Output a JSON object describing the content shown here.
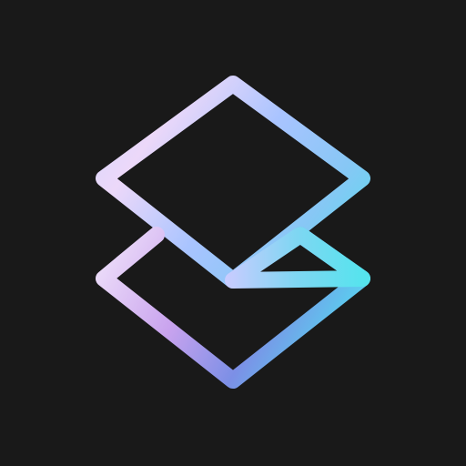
{
  "icon": {
    "name": "stacked-layers-icon",
    "background_color": "#191919",
    "gradient_colors": [
      "#f3e3fb",
      "#c9c6ff",
      "#8fc0ff",
      "#5ed2ea",
      "#58e3ee",
      "#5a86e0",
      "#d9a9ef"
    ]
  }
}
